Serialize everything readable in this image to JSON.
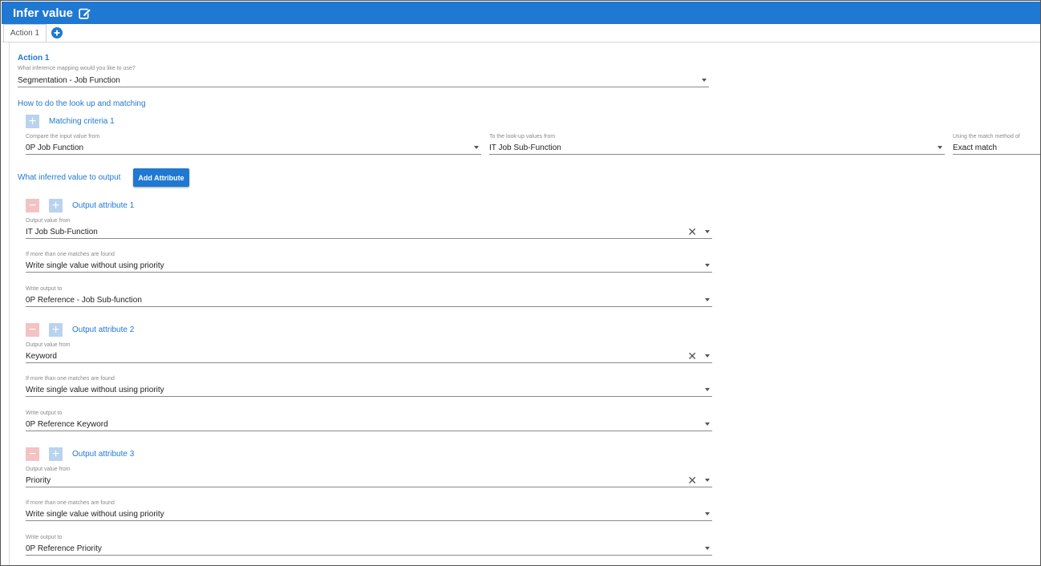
{
  "window": {
    "title": "Infer value"
  },
  "tabs": [
    {
      "label": "Action 1"
    }
  ],
  "action": {
    "title": "Action 1",
    "mapping_label": "What inference mapping would you like to use?",
    "mapping_value": "Segmentation - Job Function"
  },
  "lookup": {
    "heading": "How to do the look up and matching",
    "criteria_title": "Matching criteria 1",
    "compare_label": "Compare the input value from",
    "compare_value": "0P Job Function",
    "lookup_label": "To the look-up values from",
    "lookup_value": "IT Job Sub-Function",
    "method_label": "Using the match method of",
    "method_value": "Exact match"
  },
  "output": {
    "heading": "What inferred value to output",
    "add_button": "Add Attribute",
    "attributes": [
      {
        "title": "Output attribute 1",
        "value_label": "Output value from",
        "value": "IT Job Sub-Function",
        "multi_label": "If more than one matches are found",
        "multi_value": "Write single value without using priority",
        "write_label": "Write output to",
        "write_value": "0P Reference - Job Sub-function"
      },
      {
        "title": "Output attribute 2",
        "value_label": "Output value from",
        "value": "Keyword",
        "multi_label": "If more than one matches are found",
        "multi_value": "Write single value without using priority",
        "write_label": "Write output to",
        "write_value": "0P Reference Keyword"
      },
      {
        "title": "Output attribute 3",
        "value_label": "Output value from",
        "value": "Priority",
        "multi_label": "If more than one matches are found",
        "multi_value": "Write single value without using priority",
        "write_label": "Write output to",
        "write_value": "0P Reference Priority"
      }
    ]
  },
  "colors": {
    "accent": "#1f78d1",
    "plus_bg": "#b9d3ef",
    "minus_bg": "#f3c3c3"
  }
}
